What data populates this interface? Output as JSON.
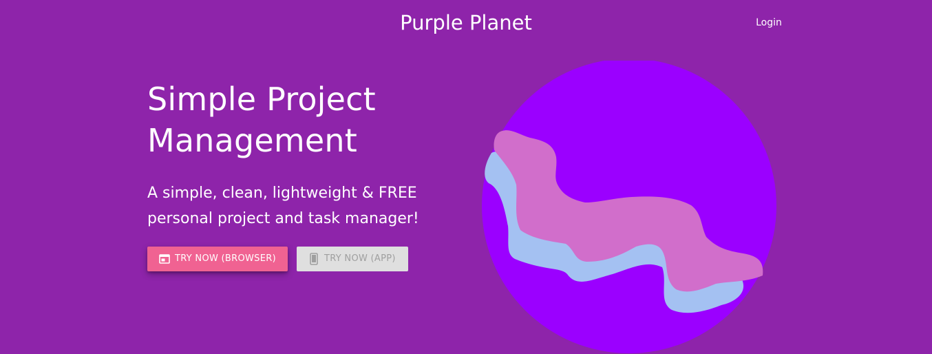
{
  "nav": {
    "brand": "Purple Planet",
    "login": "Login"
  },
  "hero": {
    "headline": "Simple Project Management",
    "tagline": "A simple, clean, lightweight & FREE personal project and task manager!",
    "buttons": [
      {
        "label": "TRY NOW (BROWSER)",
        "icon": "browser-window-icon"
      },
      {
        "label": "TRY NOW (APP)",
        "icon": "mobile-phone-icon"
      }
    ]
  },
  "colors": {
    "background": "#8e24aa",
    "planet": "#9b00ff",
    "wave_front": "#d16ecb",
    "wave_back": "#a4c1f2",
    "primary_button": "#f06292",
    "disabled_button": "#dfdfdf"
  }
}
